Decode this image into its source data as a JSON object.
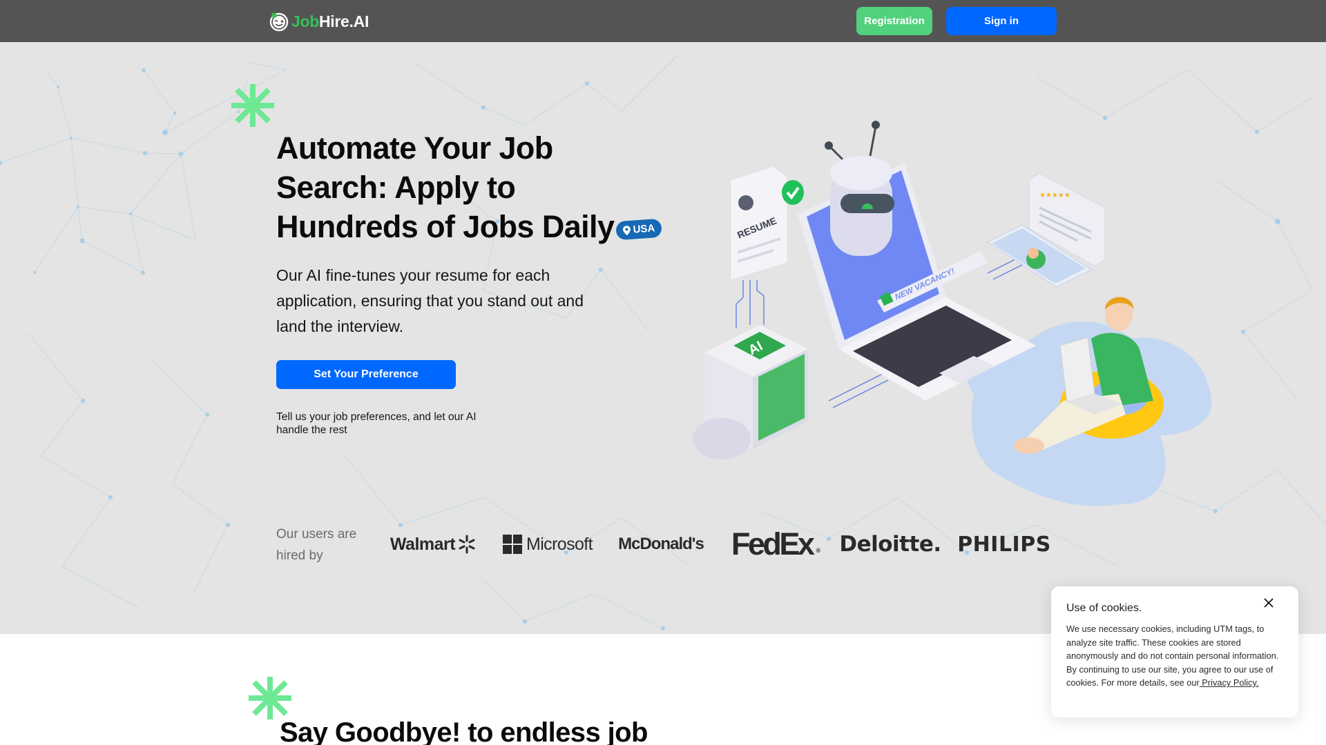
{
  "header": {
    "logo": {
      "part1": "Job",
      "part2": "Hire.AI"
    },
    "registration_label": "Registration",
    "signin_label": "Sign in"
  },
  "hero": {
    "headline_lines": [
      "Automate Your Job",
      "Search: Apply to",
      "Hundreds of Jobs Daily"
    ],
    "location_badge": "USA",
    "subtext": "Our AI fine-tunes your resume for each application, ensuring that you stand out and land the interview.",
    "cta_label": "Set Your Preference",
    "cta_note": "Tell us your job preferences, and let our AI handle the rest",
    "illustration": {
      "resume_label": "RESUME",
      "vacancy_label": "NEW VACANCY!",
      "ai_label": "AI"
    }
  },
  "hired_by": {
    "label": "Our users are hired by",
    "companies": [
      "Walmart",
      "Microsoft",
      "McDonald's",
      "FedEx",
      "Deloitte.",
      "PHILIPS"
    ]
  },
  "section2": {
    "title": "Say Goodbye! to endless job"
  },
  "cookie": {
    "title": "Use of cookies.",
    "body": "We use necessary cookies, including UTM tags, to analyze site traffic. These cookies are stored anonymously and do not contain personal information. By continuing to use our site, you agree to our use of cookies. For more details, see our",
    "link_label": " Privacy Policy."
  },
  "colors": {
    "header_bg": "#545454",
    "brand_green": "#35c15a",
    "registration_green": "#52d17c",
    "primary_blue": "#0068ff",
    "asterisk_green": "#6ee895",
    "hero_bg": "#e4e4e4",
    "badge_blue": "#1769b5"
  }
}
